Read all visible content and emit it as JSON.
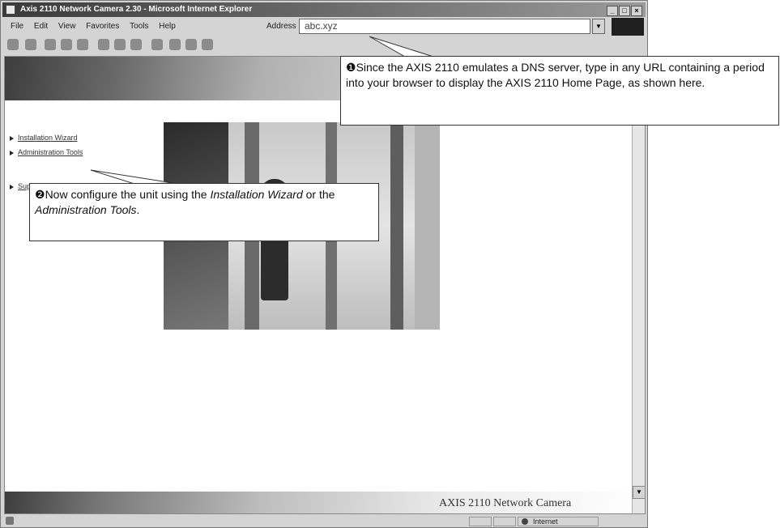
{
  "window": {
    "title": "Axis 2110 Network Camera 2.30 - Microsoft Internet Explorer",
    "controls": [
      "_",
      "□",
      "×"
    ]
  },
  "menu": [
    "File",
    "Edit",
    "View",
    "Favorites",
    "Tools",
    "Help"
  ],
  "address": {
    "label": "Address",
    "value": "abc.xyz"
  },
  "nav": {
    "links": [
      "Installation Wizard",
      "Administration Tools",
      "Support info"
    ]
  },
  "footer": {
    "brand": "AXIS 2110 Network Camera"
  },
  "status": {
    "zone": "Internet"
  },
  "callouts": {
    "one": {
      "number": "❶",
      "text": "Since the AXIS 2110 emulates a DNS server, type in any URL containing a period into your browser to display the AXIS 2110 Home Page, as shown here."
    },
    "two": {
      "number": "❷",
      "prefix": "Now configure the unit using the ",
      "em1": "Installation Wizard",
      "mid": " or the ",
      "em2": "Administration Tools",
      "suffix": "."
    }
  }
}
